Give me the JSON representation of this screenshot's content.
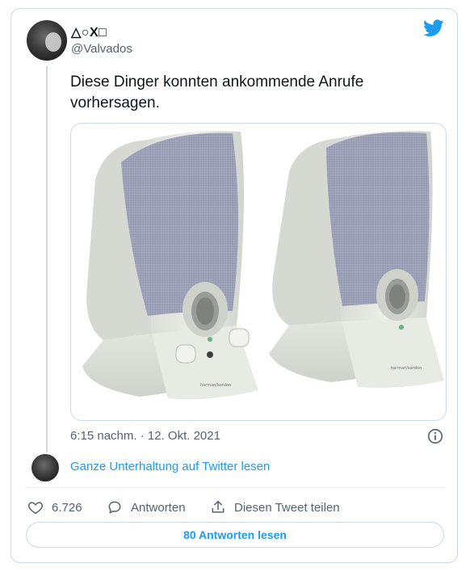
{
  "author": {
    "display_name": "△○X□",
    "handle": "@Valvados"
  },
  "tweet": {
    "text": "Diese Dinger konnten ankommende Anrufe vorhersagen.",
    "timestamp": "6:15 nachm. · 12. Okt. 2021",
    "image_text": "harman/kardon"
  },
  "links": {
    "read_conversation": "Ganze Unterhaltung auf Twitter lesen"
  },
  "actions": {
    "likes": "6.726",
    "reply_label": "Antworten",
    "share_label": "Diesen Tweet teilen"
  },
  "buttons": {
    "read_replies": "80 Antworten lesen"
  },
  "colors": {
    "accent": "#1d9bf0",
    "secondary_text": "#536471",
    "border": "#cfd9de"
  },
  "icons": [
    "twitter-bird-icon",
    "info-icon",
    "heart-icon",
    "reply-bubble-icon",
    "share-icon"
  ]
}
